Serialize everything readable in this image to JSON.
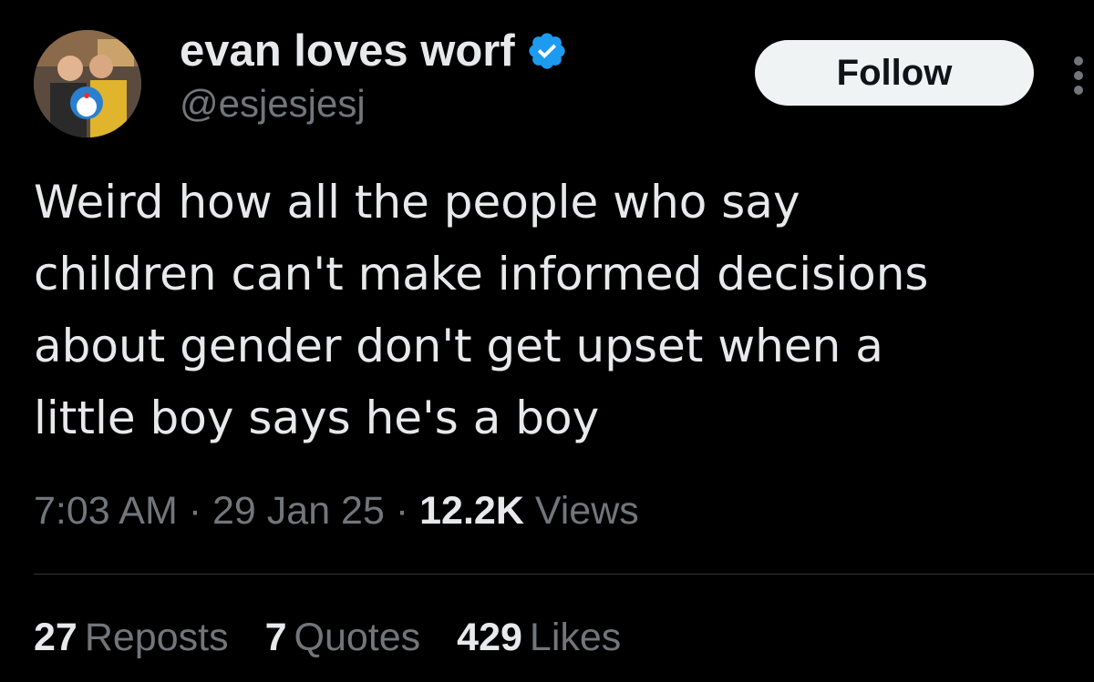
{
  "author": {
    "display_name": "evan loves worf",
    "handle": "@esjesjesj",
    "verified": true,
    "verified_icon": "verified-badge-icon",
    "verified_color": "#1d9bf0"
  },
  "actions": {
    "follow_label": "Follow",
    "more_icon": "more-vertical-icon"
  },
  "tweet": {
    "text_lines": [
      "Weird how all the people who say",
      "children can't make informed decisions",
      "about gender don't get upset when a",
      "little boy says he's a boy"
    ]
  },
  "meta": {
    "time": "7:03 AM",
    "separator": "·",
    "date": "29 Jan 25",
    "views_count": "12.2K",
    "views_label": "Views"
  },
  "stats": {
    "reposts_count": "27",
    "reposts_label": "Reposts",
    "quotes_count": "7",
    "quotes_label": "Quotes",
    "likes_count": "429",
    "likes_label": "Likes"
  },
  "colors": {
    "background": "#000000",
    "primary_text": "#e7e9ea",
    "secondary_text": "#71767b",
    "divider": "#2f3336",
    "button_bg": "#eff3f4"
  }
}
